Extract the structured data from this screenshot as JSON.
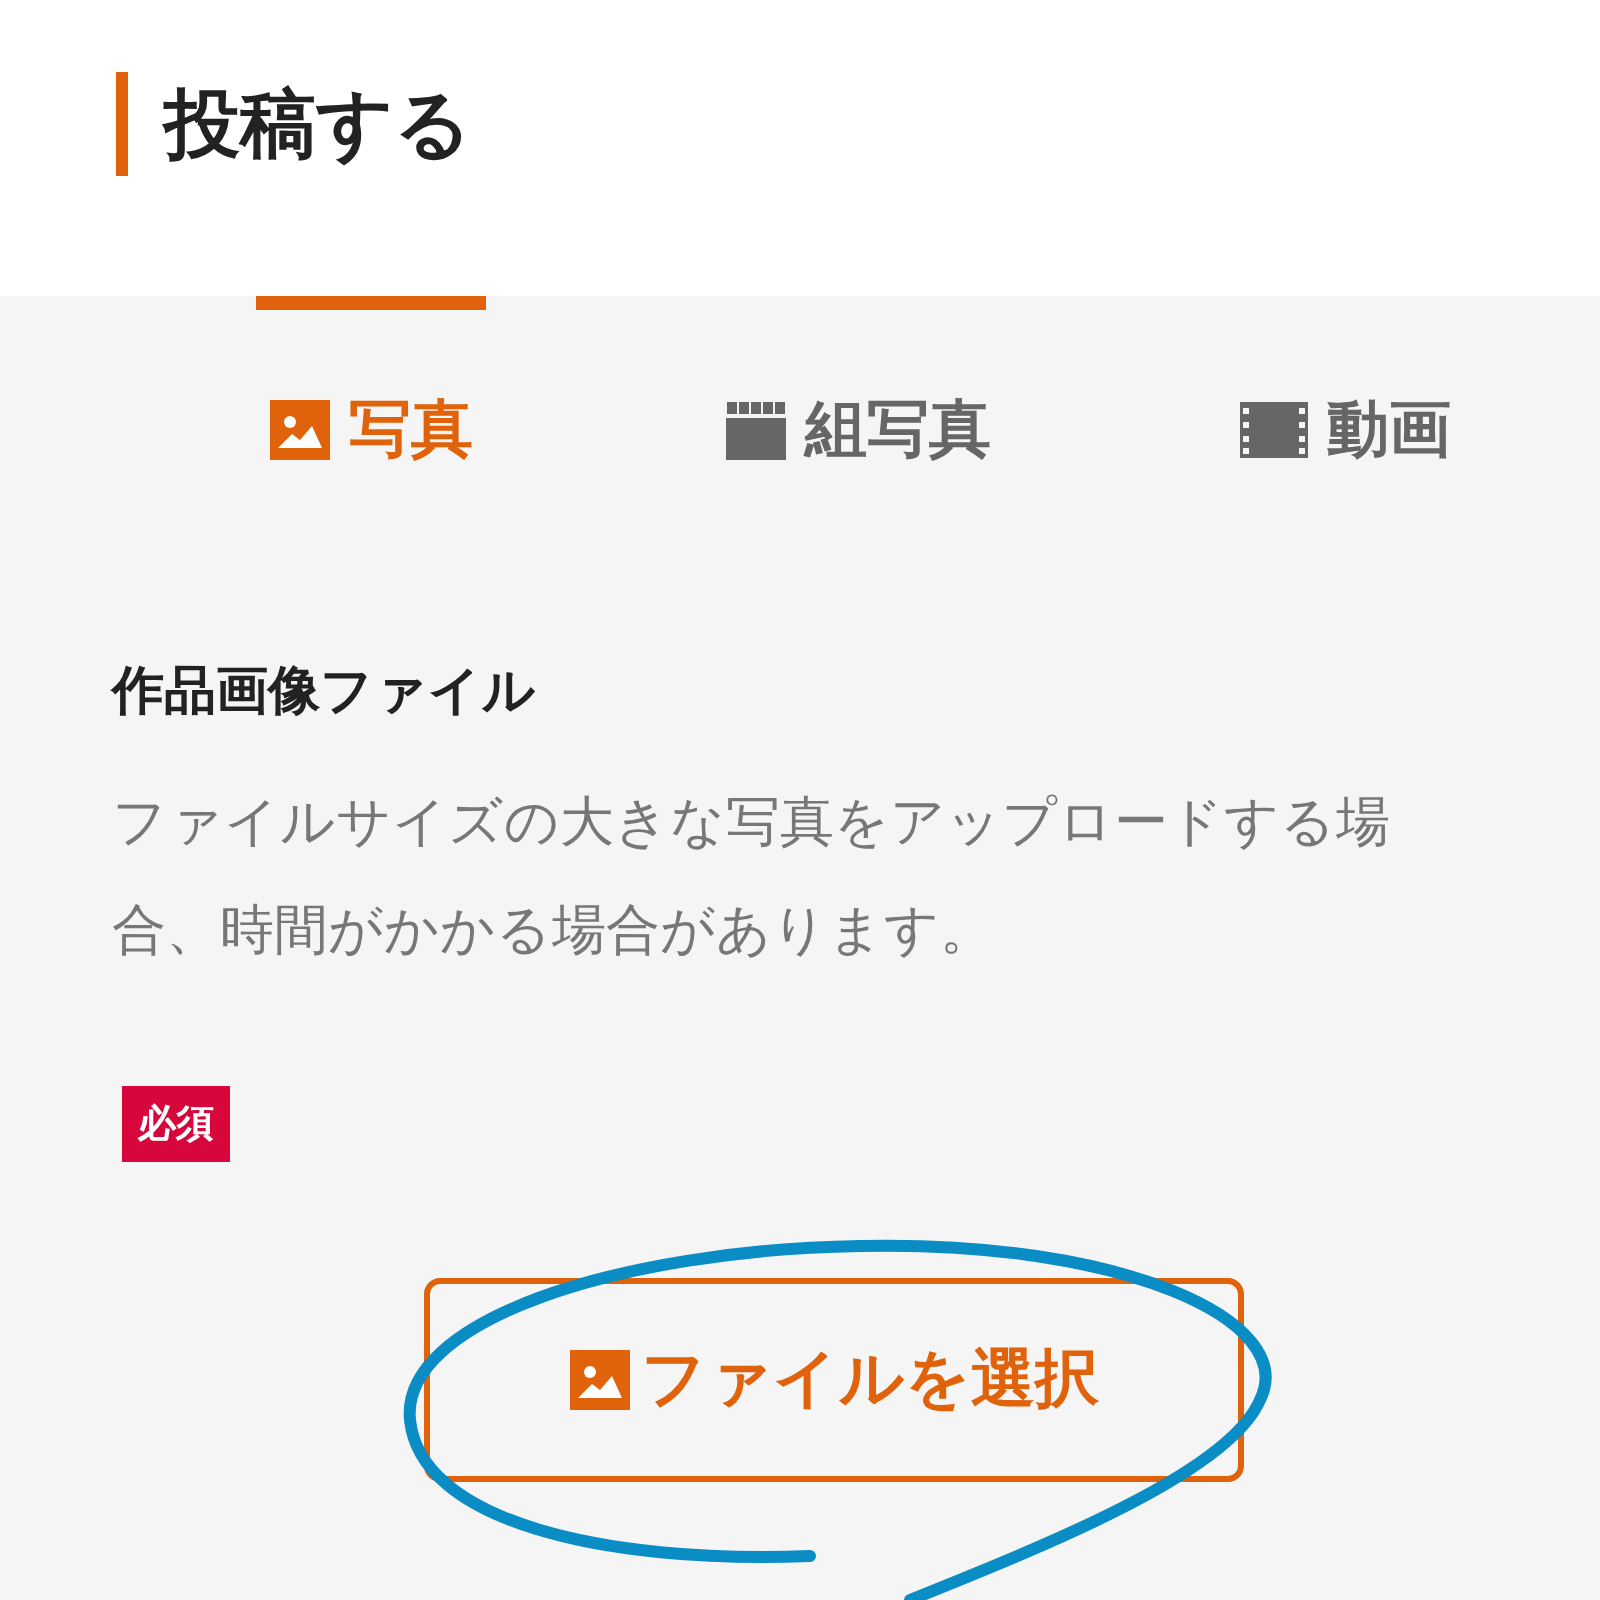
{
  "header": {
    "title": "投稿する"
  },
  "tabs": [
    {
      "label": "写真",
      "kind": "photo",
      "selected": true
    },
    {
      "label": "組写真",
      "kind": "set",
      "selected": false
    },
    {
      "label": "動画",
      "kind": "video",
      "selected": false
    }
  ],
  "section": {
    "title": "作品画像ファイル",
    "description": "ファイルサイズの大きな写真をアップロードする場合、時間がかかる場合があります。",
    "badge": "必須",
    "button": "ファイルを選択"
  }
}
